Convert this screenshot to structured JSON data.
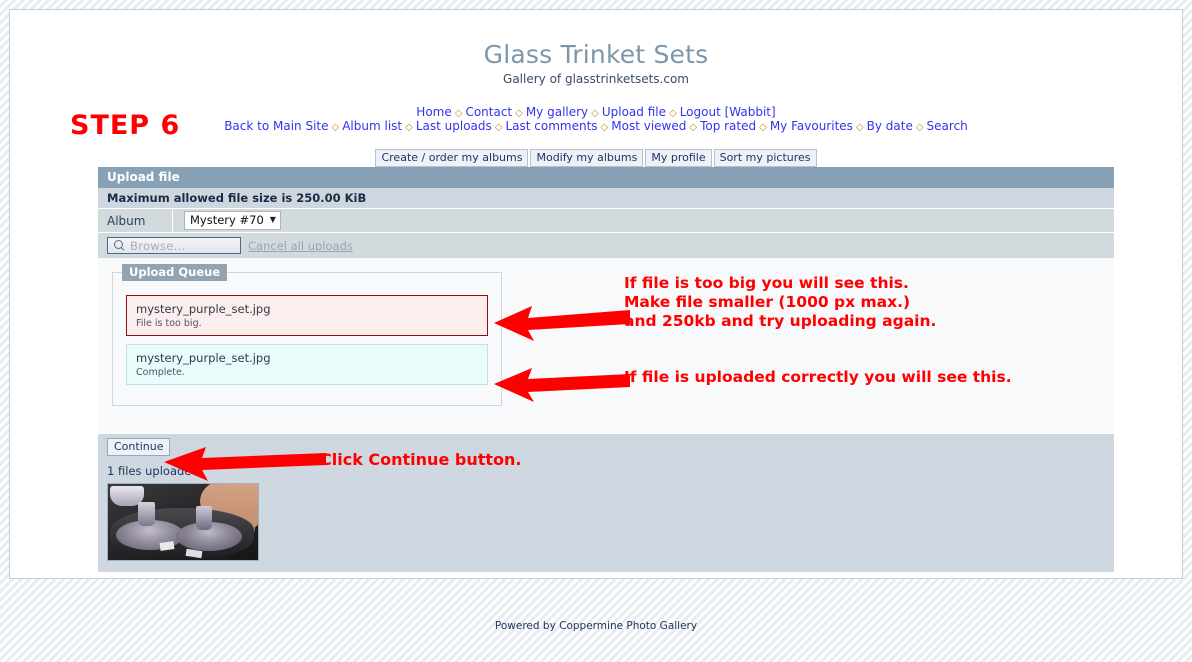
{
  "site": {
    "title": "Glass Trinket Sets",
    "subtitle": "Gallery of glasstrinketsets.com"
  },
  "nav": {
    "separator": "◇",
    "primary": [
      "Home",
      "Contact",
      "My gallery",
      "Upload file",
      "Logout [Wabbit]"
    ],
    "secondary": [
      "Back to Main Site",
      "Album list",
      "Last uploads",
      "Last comments",
      "Most viewed",
      "Top rated",
      "My Favourites",
      "By date",
      "Search"
    ]
  },
  "admin_buttons": [
    "Create / order my albums",
    "Modify my albums",
    "My profile",
    "Sort my pictures"
  ],
  "step_label": "STEP 6",
  "panel": {
    "title": "Upload file",
    "max_size_note": "Maximum allowed file size is 250.00 KiB",
    "album_label": "Album",
    "album_selected": "Mystery #70",
    "album_caret": "▼",
    "browse_placeholder": "Browse...",
    "browse_icon": "magnifier-icon",
    "cancel_all_label": "Cancel all uploads",
    "queue_legend": "Upload Queue",
    "queue_items": [
      {
        "filename": "mystery_purple_set.jpg",
        "status": "File is too big.",
        "state": "error"
      },
      {
        "filename": "mystery_purple_set.jpg",
        "status": "Complete.",
        "state": "done"
      }
    ],
    "continue_label": "Continue",
    "results_label": "1 files uploaded:",
    "thumbnail_alt": "mystery_purple_set.jpg thumbnail"
  },
  "annotations": {
    "too_big": "If file is too big you will see this.\nMake file smaller (1000 px max.)\nand 250kb and try uploading again.",
    "too_big_lines": [
      "If file is too big you will see this.",
      "Make file smaller (1000 px max.)",
      "and 250kb and try uploading again."
    ],
    "uploaded_ok": "If file is uploaded correctly you will see this.",
    "click_continue": "Click Continue button."
  },
  "footer": "Powered by Coppermine Photo Gallery",
  "colors": {
    "annotation_red": "#ff0000",
    "panel_title_bg": "#87a2b6",
    "panel_note_bg": "#ced7e0",
    "panel_row_bg": "#d3dade",
    "queue_error_bg": "#fdeeee",
    "queue_error_border": "#8b1111",
    "queue_done_bg": "#eafbfc",
    "queue_done_border": "#bfe2e8",
    "site_title": "#7c96ab",
    "link": "#3333ee",
    "nav_separator": "#cc8822"
  }
}
